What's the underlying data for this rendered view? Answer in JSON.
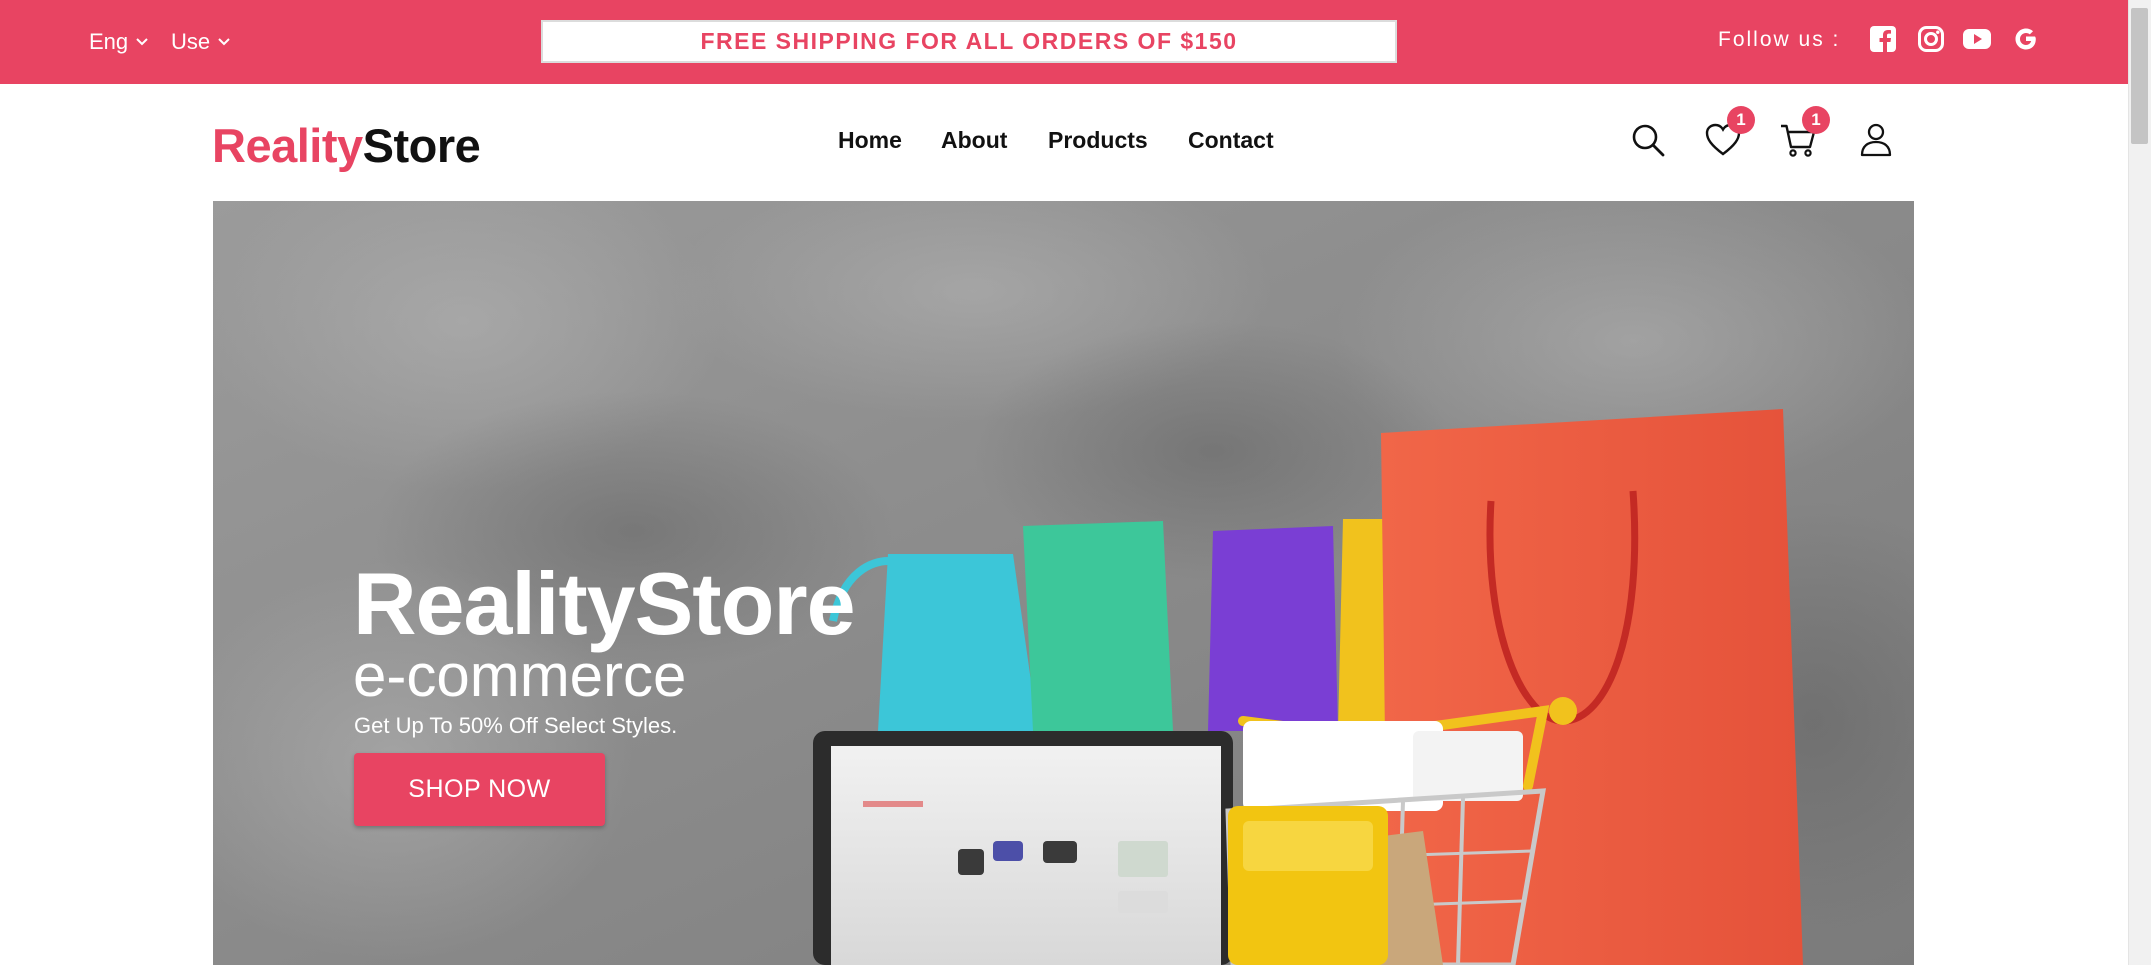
{
  "topbar": {
    "language": "Eng",
    "currency": "Use",
    "promo": "FREE SHIPPING FOR ALL ORDERS OF $150",
    "follow_label": "Follow us :",
    "social_icons": [
      "facebook-icon",
      "instagram-icon",
      "youtube-icon",
      "google-icon"
    ],
    "background": "#e84462"
  },
  "header": {
    "logo_part1": "Reality",
    "logo_part2": "Store",
    "nav": [
      "Home",
      "About",
      "Products",
      "Contact"
    ],
    "icons": [
      "search-icon",
      "heart-icon",
      "cart-icon",
      "user-icon"
    ],
    "wishlist_count": "1",
    "cart_count": "1"
  },
  "hero": {
    "title": "RealityStore",
    "subtitle": "e-commerce",
    "tagline": "Get Up To 50% Off Select Styles.",
    "button": "SHOP NOW"
  },
  "colors": {
    "accent": "#e84462",
    "text": "#111111",
    "white": "#ffffff"
  }
}
